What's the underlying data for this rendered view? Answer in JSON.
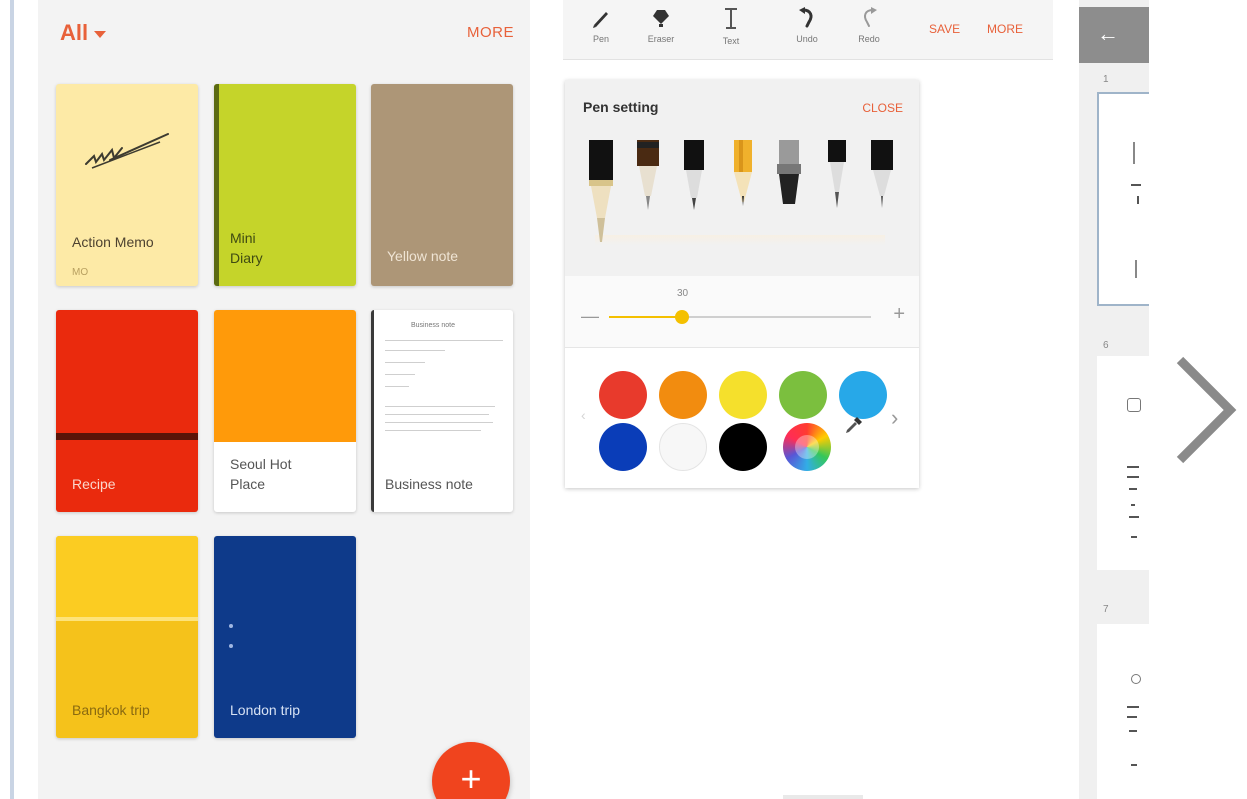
{
  "notes": {
    "filter_label": "All",
    "more_label": "MORE",
    "cards": [
      {
        "title": "Action Memo",
        "subtitle": "MO"
      },
      {
        "title": "Mini\nDiary"
      },
      {
        "title": "Yellow note"
      },
      {
        "title": "Recipe"
      },
      {
        "title": "Seoul Hot\nPlace"
      },
      {
        "title": "Business note",
        "header_text": "Business note"
      },
      {
        "title": "Bangkok trip"
      },
      {
        "title": "London trip"
      }
    ],
    "fab_label": "+"
  },
  "editor": {
    "tools": [
      {
        "label": "Pen",
        "icon": "pen-icon"
      },
      {
        "label": "Eraser",
        "icon": "eraser-icon"
      },
      {
        "label": "Text",
        "icon": "text-cursor-icon"
      },
      {
        "label": "Undo",
        "icon": "undo-icon"
      },
      {
        "label": "Redo",
        "icon": "redo-icon"
      }
    ],
    "save_label": "SAVE",
    "more_label": "MORE",
    "pen_setting": {
      "title": "Pen setting",
      "close_label": "CLOSE",
      "size_value": "30",
      "size_fraction": 0.28,
      "colors": [
        "#e83a2c",
        "#f28c0f",
        "#f5e02c",
        "#7bbf3e",
        "#27a8e8",
        "#0a3db8",
        "#f7f7f7",
        "#000000"
      ],
      "selected_pen": 3
    }
  },
  "pages": {
    "page_numbers": [
      "1",
      "6",
      "7"
    ],
    "back_icon": "arrow-left-icon"
  },
  "next_icon": "chevron-right-icon"
}
